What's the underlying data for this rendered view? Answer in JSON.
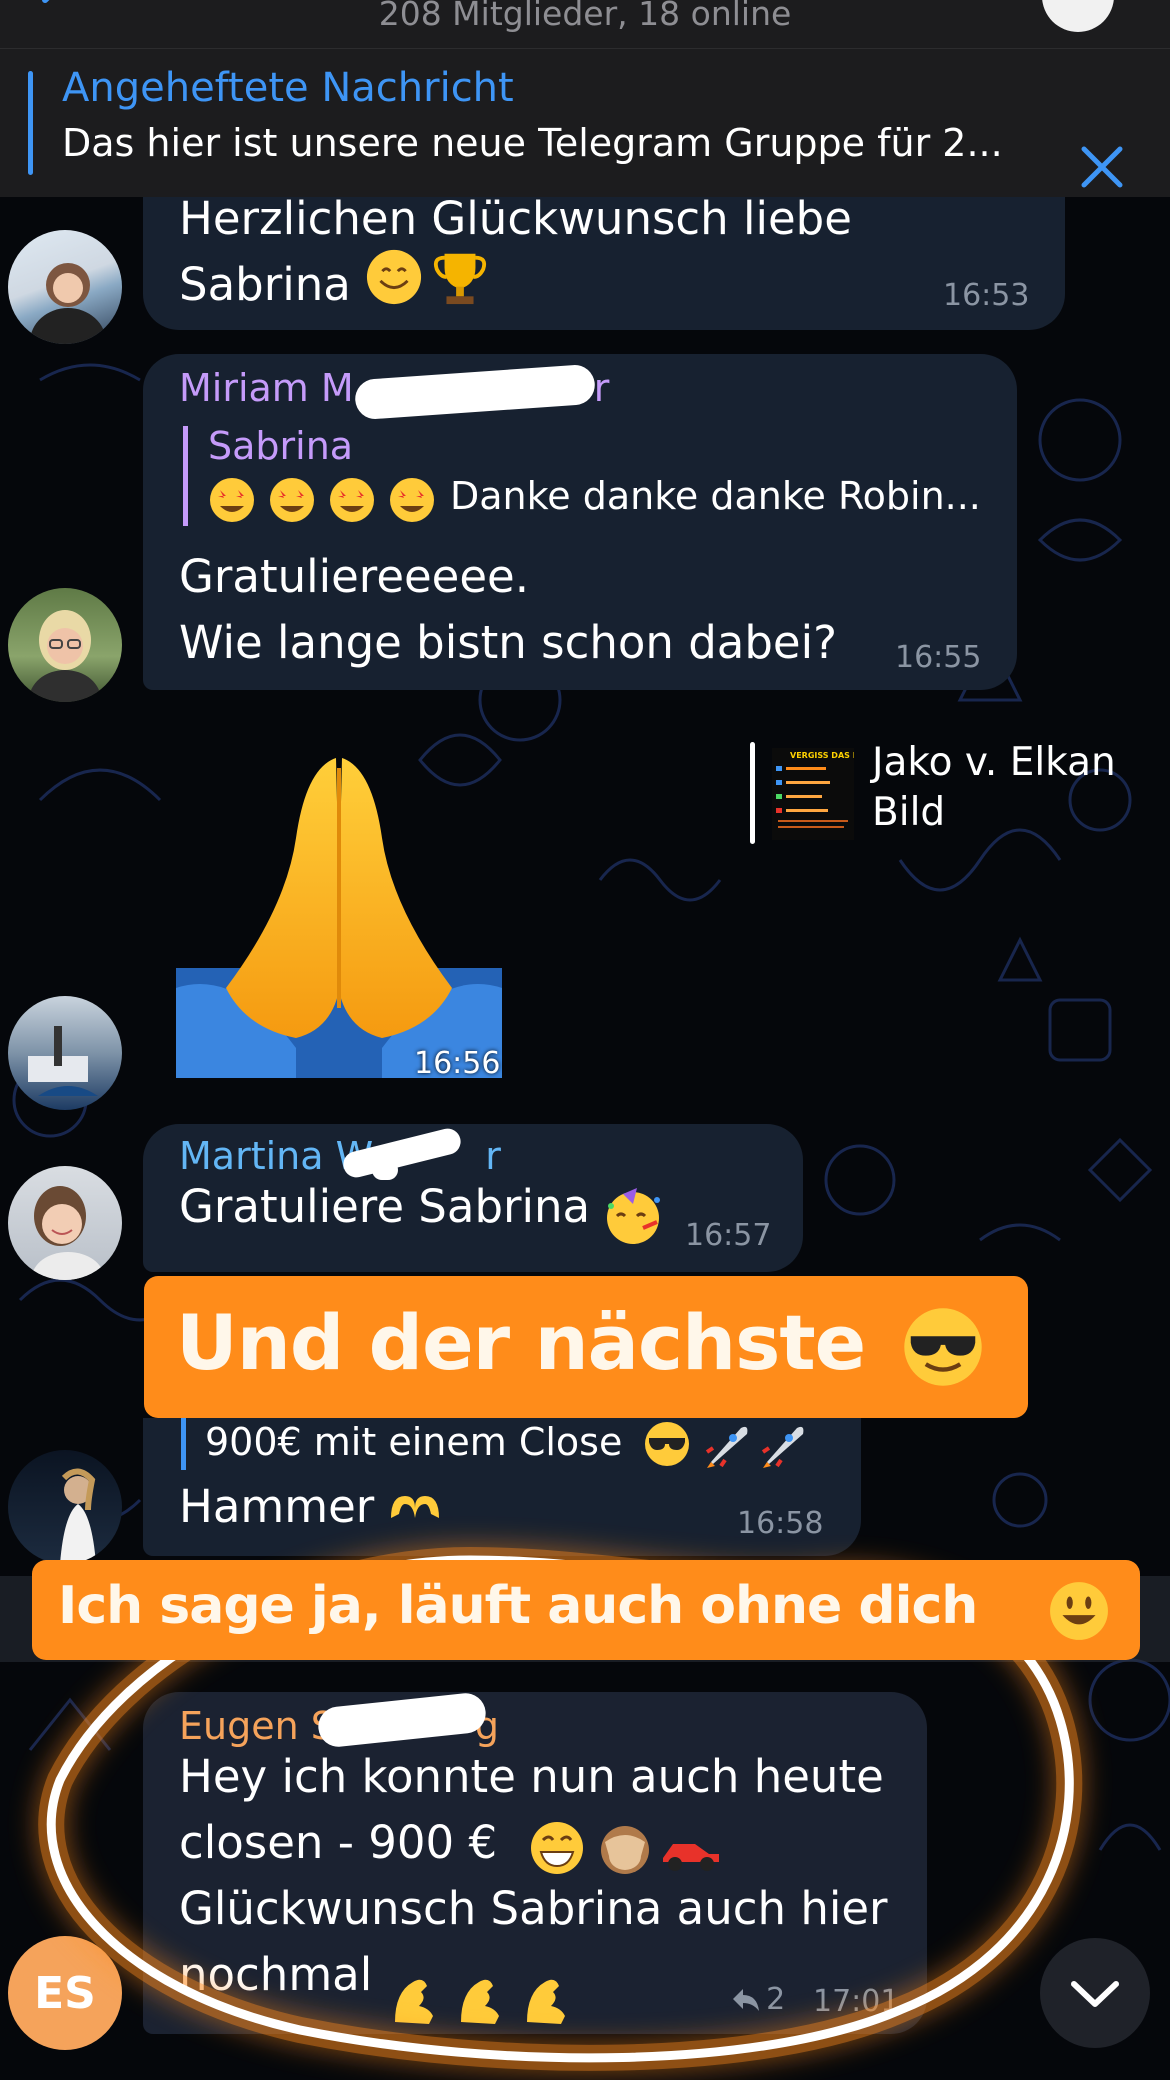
{
  "header": {
    "subtitle": "208 Mitglieder, 18 online"
  },
  "pinned": {
    "title": "Angeheftete Nachricht",
    "text": "Das hier ist unsere neue Telegram Gruppe für 2..."
  },
  "messages": [
    {
      "text": "Herzlichen Glückwunsch liebe\nSabrina",
      "time": "16:53"
    },
    {
      "sender": "Miriam M",
      "sender_suffix": "r",
      "reply_name": "Sabrina",
      "reply_text": "Danke danke danke Robin...",
      "text": "Gratuliereeeee.\nWie lange bistn schon dabei?",
      "time": "16:55"
    },
    {
      "reply_name": "Jako v. Elkan",
      "reply_text": "Bild",
      "time": "16:56"
    },
    {
      "sender": "Martina W",
      "sender_suffix": "r",
      "text": "Gratuliere Sabrina",
      "time": "16:57"
    },
    {
      "reply_text": "900€ mit einem Close",
      "text": "Hammer",
      "time": "16:58"
    },
    {
      "sender": "Eugen S",
      "sender_suffix": "g",
      "text": "Hey ich konnte nun auch heute\nclosen - 900 €\nGlückwunsch Sabrina auch hier\nnochmal",
      "reply_count": "2",
      "time": "17:01",
      "avatar_initials": "ES"
    }
  ],
  "banners": {
    "top": "Und der nächste",
    "bottom": "Ich sage ja, läuft auch ohne dich"
  },
  "thumbnail_text": "VERGISS DAS NIE",
  "colors": {
    "accent": "#3e95f5",
    "bubble": "#172130",
    "sender_miriam": "#c59bfa",
    "sender_martina": "#63b6f5",
    "sender_eugen": "#f5a35b",
    "banner": "#ff8c1a"
  }
}
